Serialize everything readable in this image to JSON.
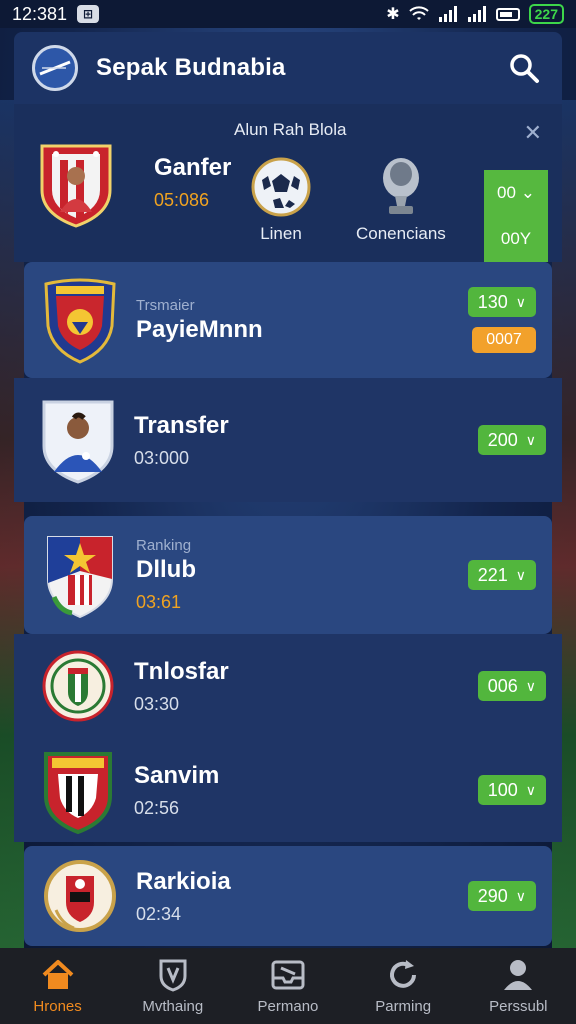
{
  "status_bar": {
    "time": "12:381",
    "battery": "227",
    "app_badge": "⊞"
  },
  "header": {
    "title": "Sepak Budnabia"
  },
  "featured": {
    "heading": "Alun Rah Blola",
    "name": "Ganfer",
    "time": "05:086",
    "trophy_left_label": "Linen",
    "trophy_right_label": "Conencians",
    "side_top": "00",
    "side_bottom": "00Y"
  },
  "rows": [
    {
      "sub": "Trsmaier",
      "name": "PayieMnnn",
      "time": "",
      "pill": "130",
      "secondary": "0007"
    },
    {
      "sub": "",
      "name": "Transfer",
      "time": "03:000",
      "pill": "200"
    },
    {
      "sub": "Ranking",
      "name": "Dllub",
      "time": "03:61",
      "pill": "221"
    },
    {
      "sub": "",
      "name": "Tnlosfar",
      "time": "03:30",
      "pill": "006"
    },
    {
      "sub": "",
      "name": "Sanvim",
      "time": "02:56",
      "pill": "100"
    },
    {
      "sub": "",
      "name": "Rarkioia",
      "time": "02:34",
      "pill": "290"
    }
  ],
  "nav": [
    {
      "label": "Hrones",
      "icon": "home-icon"
    },
    {
      "label": "Mvthaing",
      "icon": "shield-icon"
    },
    {
      "label": "Permano",
      "icon": "inbox-icon"
    },
    {
      "label": "Parming",
      "icon": "refresh-icon"
    },
    {
      "label": "Perssubl",
      "icon": "profile-icon"
    }
  ],
  "colors": {
    "accent_green": "#52b63d",
    "accent_orange": "#f2a12b",
    "background": "#13254d"
  }
}
